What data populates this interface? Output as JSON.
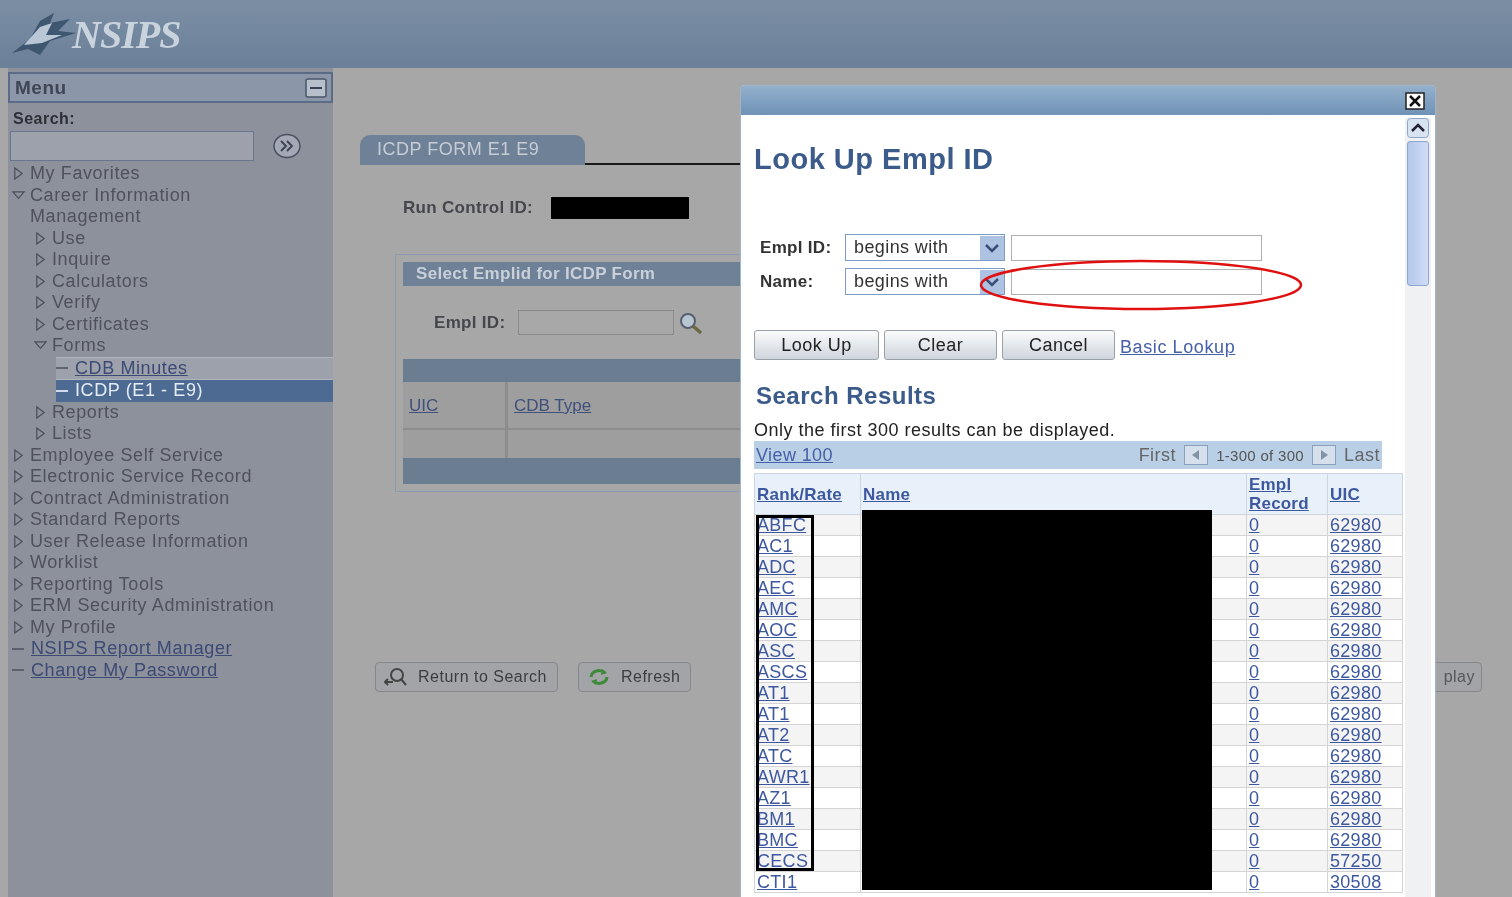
{
  "header": {
    "logo": "NSIPS"
  },
  "sidebar": {
    "title": "Menu",
    "search_label": "Search:",
    "tree": [
      {
        "label": "My Favorites",
        "kind": "folder",
        "expanded": false
      },
      {
        "label": "Career Information Management",
        "kind": "folder",
        "expanded": true,
        "children": [
          {
            "label": "Use",
            "kind": "folder",
            "expanded": false
          },
          {
            "label": "Inquire",
            "kind": "folder",
            "expanded": false
          },
          {
            "label": "Calculators",
            "kind": "folder",
            "expanded": false
          },
          {
            "label": "Verify",
            "kind": "folder",
            "expanded": false
          },
          {
            "label": "Certificates",
            "kind": "folder",
            "expanded": false
          },
          {
            "label": "Forms",
            "kind": "folder",
            "expanded": true,
            "children": [
              {
                "label": "CDB Minutes",
                "kind": "link",
                "selected": false
              },
              {
                "label": "ICDP (E1 - E9)",
                "kind": "link",
                "selected": true
              }
            ]
          },
          {
            "label": "Reports",
            "kind": "folder",
            "expanded": false
          },
          {
            "label": "Lists",
            "kind": "folder",
            "expanded": false
          }
        ]
      },
      {
        "label": "Employee Self Service",
        "kind": "folder",
        "expanded": false
      },
      {
        "label": "Electronic Service Record",
        "kind": "folder",
        "expanded": false
      },
      {
        "label": "Contract Administration",
        "kind": "folder",
        "expanded": false
      },
      {
        "label": "Standard Reports",
        "kind": "folder",
        "expanded": false
      },
      {
        "label": "User Release Information",
        "kind": "folder",
        "expanded": false
      },
      {
        "label": "Worklist",
        "kind": "folder",
        "expanded": false
      },
      {
        "label": "Reporting Tools",
        "kind": "folder",
        "expanded": false
      },
      {
        "label": "ERM Security Administration",
        "kind": "folder",
        "expanded": false
      },
      {
        "label": "My Profile",
        "kind": "folder",
        "expanded": false
      },
      {
        "label": "NSIPS Report Manager",
        "kind": "link",
        "selected": false
      },
      {
        "label": "Change My Password",
        "kind": "link",
        "selected": false
      }
    ]
  },
  "page": {
    "tab": "ICDP FORM E1 E9",
    "run_control_label": "Run Control ID:",
    "section_title": "Select Emplid for ICDP Form",
    "empl_id_label": "Empl ID:",
    "grid_columns": [
      "UIC",
      "CDB Type"
    ],
    "buttons": [
      {
        "label": "Return to Search",
        "kind": "return"
      },
      {
        "label": "Refresh",
        "kind": "refresh"
      },
      {
        "label": "play",
        "kind": "plain"
      }
    ]
  },
  "lookup": {
    "title": "Look Up Empl ID",
    "criteria": [
      {
        "label": "Empl ID:",
        "operator": "begins with"
      },
      {
        "label": "Name:",
        "operator": "begins with"
      }
    ],
    "buttons": [
      "Look Up",
      "Clear",
      "Cancel"
    ],
    "link": "Basic Lookup",
    "results_title": "Search Results",
    "note": "Only the first 300 results can be displayed.",
    "nav": {
      "view": "View 100",
      "first": "First",
      "range": "1-300 of 300",
      "last": "Last"
    },
    "columns": [
      "Rank/Rate",
      "Name",
      "Empl Record",
      "UIC"
    ],
    "rows": [
      {
        "rank": "ABFC",
        "empl_record": "0",
        "uic": "62980"
      },
      {
        "rank": "AC1",
        "empl_record": "0",
        "uic": "62980"
      },
      {
        "rank": "ADC",
        "empl_record": "0",
        "uic": "62980"
      },
      {
        "rank": "AEC",
        "empl_record": "0",
        "uic": "62980"
      },
      {
        "rank": "AMC",
        "empl_record": "0",
        "uic": "62980"
      },
      {
        "rank": "AOC",
        "empl_record": "0",
        "uic": "62980"
      },
      {
        "rank": "ASC",
        "empl_record": "0",
        "uic": "62980"
      },
      {
        "rank": "ASCS",
        "empl_record": "0",
        "uic": "62980"
      },
      {
        "rank": "AT1",
        "empl_record": "0",
        "uic": "62980"
      },
      {
        "rank": "AT1",
        "empl_record": "0",
        "uic": "62980"
      },
      {
        "rank": "AT2",
        "empl_record": "0",
        "uic": "62980"
      },
      {
        "rank": "ATC",
        "empl_record": "0",
        "uic": "62980"
      },
      {
        "rank": "AWR1",
        "empl_record": "0",
        "uic": "62980"
      },
      {
        "rank": "AZ1",
        "empl_record": "0",
        "uic": "62980"
      },
      {
        "rank": "BM1",
        "empl_record": "0",
        "uic": "62980"
      },
      {
        "rank": "BMC",
        "empl_record": "0",
        "uic": "62980"
      },
      {
        "rank": "CECS",
        "empl_record": "0",
        "uic": "57250"
      },
      {
        "rank": "CTI1",
        "empl_record": "0",
        "uic": "30508"
      }
    ]
  }
}
